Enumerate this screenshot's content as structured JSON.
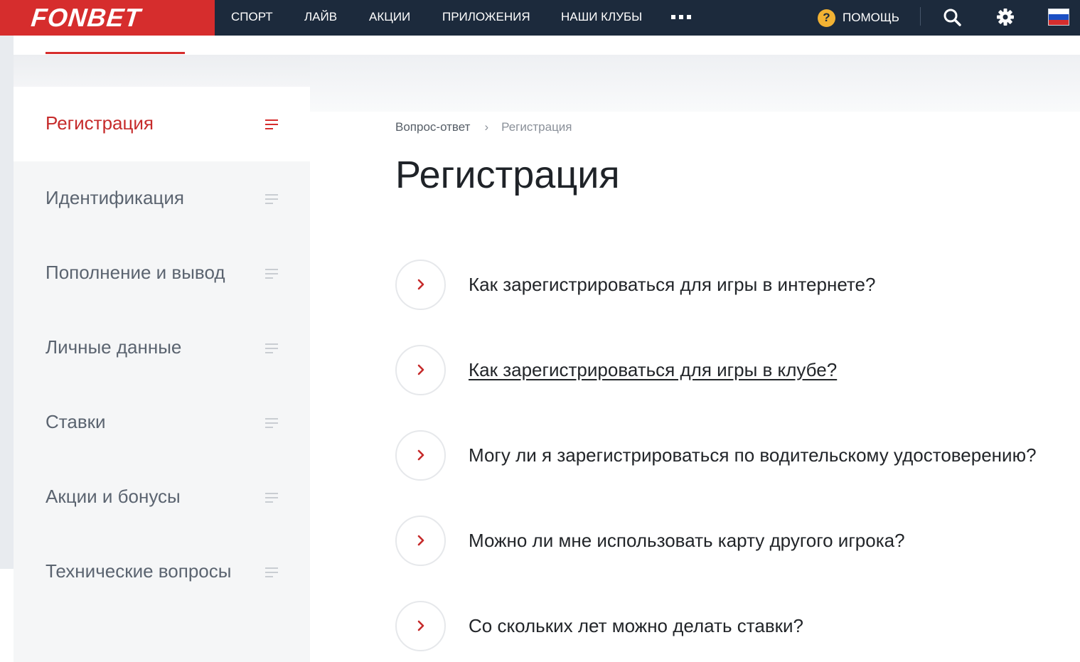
{
  "brand": {
    "logo": "FONBET",
    "colors": {
      "red": "#d62d2d",
      "navy": "#1c2a3c",
      "help_yellow": "#f2b233"
    }
  },
  "nav": {
    "items": [
      "СПОРТ",
      "ЛАЙВ",
      "АКЦИИ",
      "ПРИЛОЖЕНИЯ",
      "НАШИ КЛУБЫ"
    ],
    "more_icon": "three-dots-icon",
    "help_label": "ПОМОЩЬ",
    "help_icon": "question-circle-icon",
    "search_icon": "search-icon",
    "settings_icon": "gear-icon",
    "language_flag": "russia-flag-icon"
  },
  "sidebar": {
    "items": [
      {
        "label": "Регистрация",
        "active": true
      },
      {
        "label": "Идентификация",
        "active": false
      },
      {
        "label": "Пополнение и вывод",
        "active": false
      },
      {
        "label": "Личные данные",
        "active": false
      },
      {
        "label": "Ставки",
        "active": false
      },
      {
        "label": "Акции и бонусы",
        "active": false
      },
      {
        "label": "Технические вопросы",
        "active": false
      }
    ],
    "item_icon": "menu-lines-icon"
  },
  "breadcrumb": {
    "parent": "Вопрос-ответ",
    "separator": "›",
    "current": "Регистрация"
  },
  "main": {
    "title": "Регистрация",
    "faq_icon": "chevron-right-icon",
    "faq": [
      {
        "question": "Как зарегистрироваться для игры в интернете?",
        "hovered": false
      },
      {
        "question": "Как зарегистрироваться для игры в клубе?",
        "hovered": true
      },
      {
        "question": "Могу ли я зарегистрироваться по водительскому удостоверению?",
        "hovered": false
      },
      {
        "question": "Можно ли мне использовать карту другого игрока?",
        "hovered": false
      },
      {
        "question": "Со скольких лет можно делать ставки?",
        "hovered": false
      }
    ]
  }
}
